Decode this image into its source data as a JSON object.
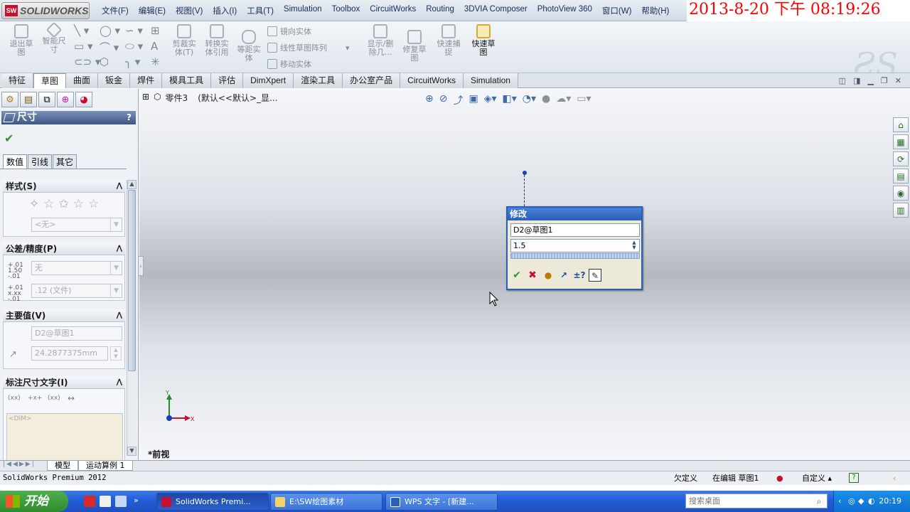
{
  "app": {
    "logo_text": "SOLIDWORKS",
    "logo_mark": "SW"
  },
  "menu": [
    "文件(F)",
    "编辑(E)",
    "视图(V)",
    "插入(I)",
    "工具(T)",
    "Simulation",
    "Toolbox",
    "CircuitWorks",
    "Routing",
    "3DVIA Composer",
    "PhotoView 360",
    "窗口(W)",
    "帮助(H)"
  ],
  "clock": "2013-8-20 下午 08:19:26",
  "toolbar": {
    "exit_sketch": "退出草\n图",
    "smart_dim": "智能尺\n寸",
    "trim": "剪裁实\n体(T)",
    "convert": "转换实\n体引用",
    "offset": "等距实\n体",
    "mirror": "镜向实体",
    "linear_pattern": "线性草图阵列",
    "move": "移动实体",
    "show_delete": "显示/删\n除几...",
    "repair": "修复草\n图",
    "quick_snap": "快速捕\n捉",
    "rapid_sketch": "快速草\n图"
  },
  "cmd_tabs": [
    "特征",
    "草图",
    "曲面",
    "钣金",
    "焊件",
    "模具工具",
    "评估",
    "DimXpert",
    "渲染工具",
    "办公室产品",
    "CircuitWorks",
    "Simulation"
  ],
  "active_tab": "草图",
  "tree": {
    "part": "零件3",
    "config": "(默认<<默认>_显..."
  },
  "pm": {
    "title": "尺寸",
    "help": "?",
    "subtabs": [
      "数值",
      "引线",
      "其它"
    ],
    "style_group": "样式(S)",
    "style_value": "<无>",
    "tolerance_group": "公差/精度(P)",
    "tolerance_value": "无",
    "precision_value": ".12 (文件)",
    "primary_group": "主要值(V)",
    "primary_name": "D2@草图1",
    "primary_value": "24.2877375mm",
    "dimtext_group": "标注尺寸文字(I)",
    "dimtext_content": "<DIM>",
    "dimtext_icons": [
      "(xx)",
      "+x+",
      "(xx)"
    ]
  },
  "modify_dialog": {
    "title": "修改",
    "name": "D2@草图1",
    "value": "1.5"
  },
  "view_label": "*前视",
  "triad": {
    "x": "X",
    "y": "Y"
  },
  "bottom_tabs": [
    "模型",
    "运动算例 1"
  ],
  "status": {
    "left": "SolidWorks Premium 2012",
    "underdefined": "欠定义",
    "editing": "在编辑 草图1",
    "custom": "自定义 ▴",
    "help": "?"
  },
  "taskbar": {
    "start": "开始",
    "tasks": [
      "SolidWorks Premi...",
      "E:\\SW绘图素材",
      "WPS 文字 - [新建..."
    ],
    "search_placeholder": "搜索桌面",
    "time": "20:19"
  }
}
